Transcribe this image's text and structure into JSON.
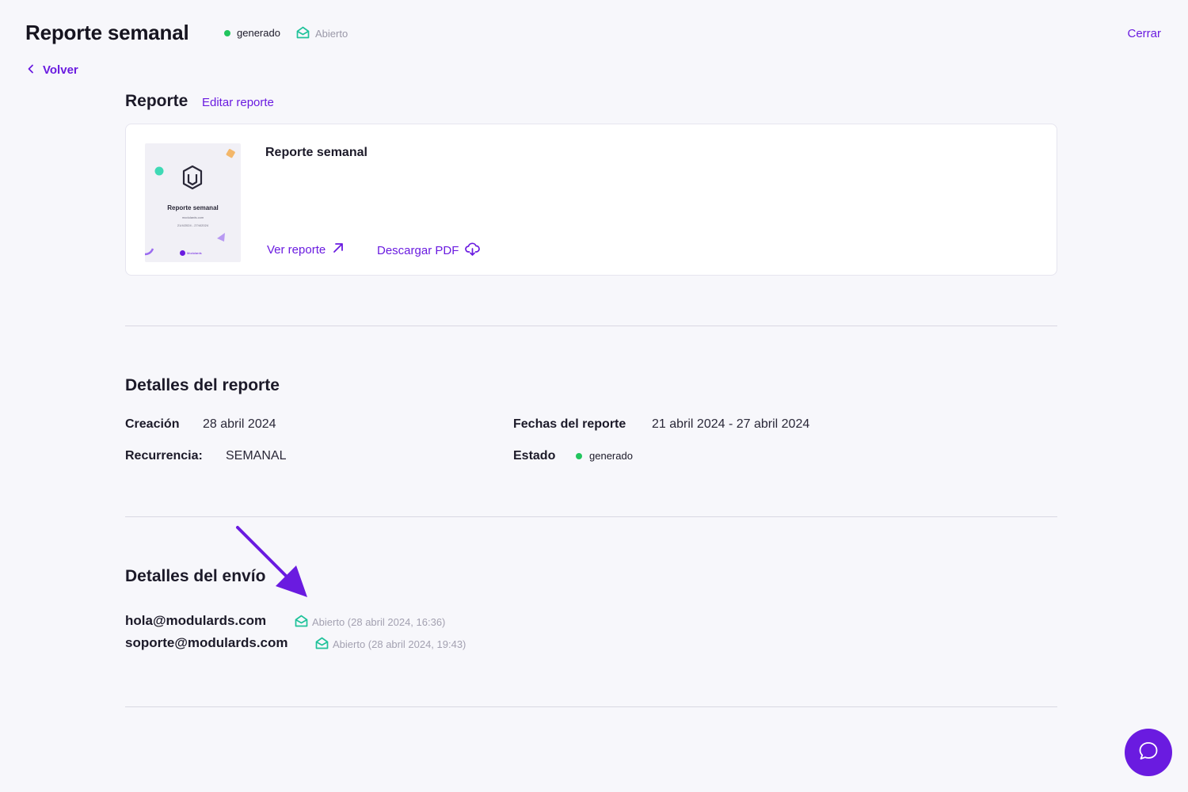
{
  "colors": {
    "accent": "#6a1be0",
    "status_green": "#22c55e",
    "open_green": "#1fc29a",
    "divider": "#d9d8e2",
    "background": "#f7f7fb"
  },
  "header": {
    "title": "Reporte semanal",
    "status_label": "generado",
    "open_label": "Abierto",
    "close_label": "Cerrar",
    "back_label": "Volver"
  },
  "report": {
    "section_title": "Reporte",
    "edit_label": "Editar reporte",
    "card_name": "Reporte semanal",
    "thumbnail": {
      "title": "Reporte semanal",
      "subtitle": "modulards.com",
      "dates": "21/4/2024 - 27/4/2024",
      "brand": "Modulards"
    },
    "view_label": "Ver reporte",
    "download_label": "Descargar PDF"
  },
  "details": {
    "section_title": "Detalles del reporte",
    "creation_label": "Creación",
    "creation_value": "28 abril 2024",
    "recurrence_label": "Recurrencia:",
    "recurrence_value": "SEMANAL",
    "dates_label": "Fechas del reporte",
    "dates_value": "21 abril 2024 - 27 abril 2024",
    "status_label": "Estado",
    "status_value": "generado"
  },
  "shipping": {
    "section_title": "Detalles del envío",
    "recipients": [
      {
        "email": "hola@modulards.com",
        "status": "Abierto (28 abril 2024, 16:36)"
      },
      {
        "email": "soporte@modulards.com",
        "status": "Abierto (28 abril 2024, 19:43)"
      }
    ]
  },
  "icons": [
    "chevron-left-icon",
    "envelope-open-icon",
    "arrow-up-right-icon",
    "cloud-download-icon",
    "chat-bubble-icon",
    "annotation-arrow-icon"
  ]
}
